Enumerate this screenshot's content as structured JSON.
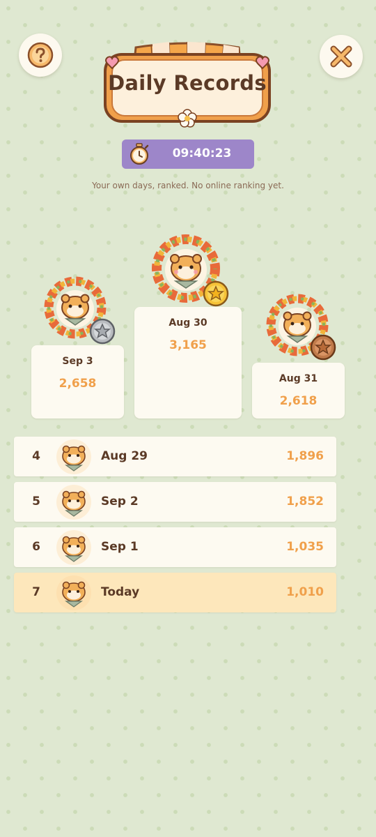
{
  "header": {
    "title": "Daily Records",
    "help_icon": "question-mark-icon",
    "close_icon": "close-x-icon"
  },
  "timer": {
    "icon": "stopwatch-icon",
    "value": "09:40:23"
  },
  "subtitle": "Your own days, ranked. No online ranking yet.",
  "podium": {
    "first": {
      "date": "Aug 30",
      "score": "3,165",
      "medal": "gold-star-medal-icon"
    },
    "second": {
      "date": "Sep 3",
      "score": "2,658",
      "medal": "silver-star-medal-icon"
    },
    "third": {
      "date": "Aug 31",
      "score": "2,618",
      "medal": "bronze-star-medal-icon"
    }
  },
  "list": [
    {
      "rank": "4",
      "date": "Aug 29",
      "score": "1,896"
    },
    {
      "rank": "5",
      "date": "Sep 2",
      "score": "1,852"
    },
    {
      "rank": "6",
      "date": "Sep 1",
      "score": "1,035"
    },
    {
      "rank": "7",
      "date": "Today",
      "score": "1,010",
      "highlighted": true
    }
  ],
  "colors": {
    "background": "#dfe8d1",
    "card": "#fdfaf1",
    "highlight_row": "#fde7bb",
    "timer_bg": "#9d86c9",
    "score": "#f0a04b",
    "text_dark": "#5b3a26"
  }
}
